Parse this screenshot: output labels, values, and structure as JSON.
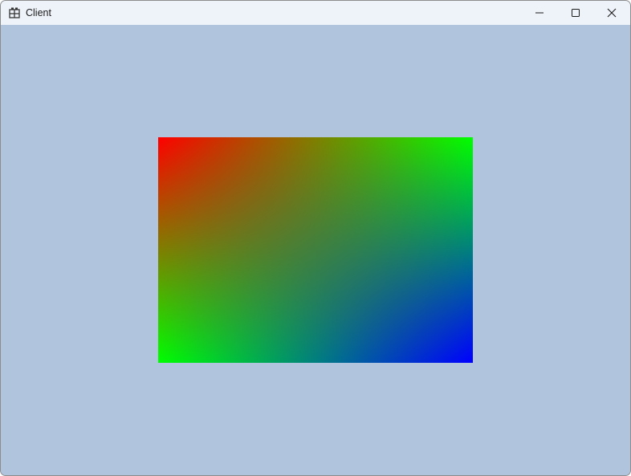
{
  "window": {
    "title": "Client",
    "app_icon": "app-window-icon",
    "background_color": "#b0c4de",
    "titlebar_color": "#eef2f9"
  },
  "caption_buttons": {
    "minimize": "minimize-icon",
    "maximize": "maximize-icon",
    "close": "close-icon"
  },
  "quad": {
    "corner_colors": {
      "top_left": "#ff0000",
      "top_right": "#00ff00",
      "bottom_left": "#00ff00",
      "bottom_right": "#0000ff"
    }
  }
}
